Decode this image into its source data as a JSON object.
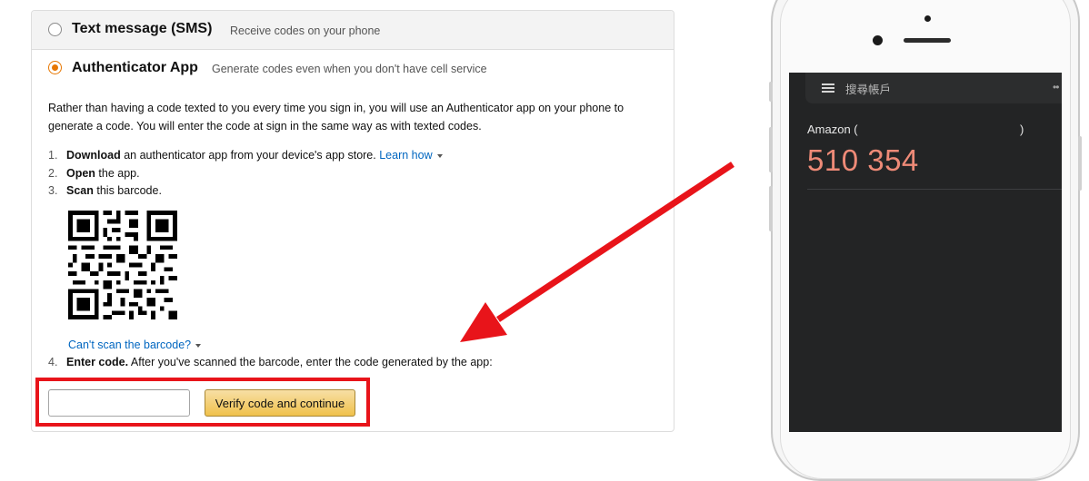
{
  "sms_option": {
    "title": "Text message (SMS)",
    "subtitle": "Receive codes on your phone",
    "selected": false
  },
  "auth_option": {
    "title": "Authenticator App",
    "subtitle": "Generate codes even when you don't have cell service",
    "selected": true
  },
  "instructions": {
    "paragraph": "Rather than having a code texted to you every time you sign in, you will use an Authenticator app on your phone to generate a code. You will enter the code at sign in the same way as with texted codes.",
    "steps": [
      {
        "num": "1.",
        "bold": "Download",
        "text": " an authenticator app from your device's app store. ",
        "link": "Learn how"
      },
      {
        "num": "2.",
        "bold": "Open",
        "text": " the app."
      },
      {
        "num": "3.",
        "bold": "Scan",
        "text": " this barcode."
      },
      {
        "num": "4.",
        "bold": "Enter code.",
        "text": " After you've scanned the barcode, enter the code generated by the app:"
      }
    ],
    "cant_scan_link": "Can't scan the barcode?"
  },
  "form": {
    "code_value": "",
    "verify_label": "Verify code and continue"
  },
  "colors": {
    "highlight": "#e8141a",
    "arrow": "#e8141a",
    "radio_selected": "#e77600",
    "link": "#0066c0",
    "otp_code": "#ee8a77",
    "screen_bg": "#232425"
  },
  "phone": {
    "search_label": "搜尋帳戶",
    "account_name": "Amazon (",
    "account_close": ")",
    "otp_code": "510 354",
    "more_icon": "more-vert-icon"
  }
}
